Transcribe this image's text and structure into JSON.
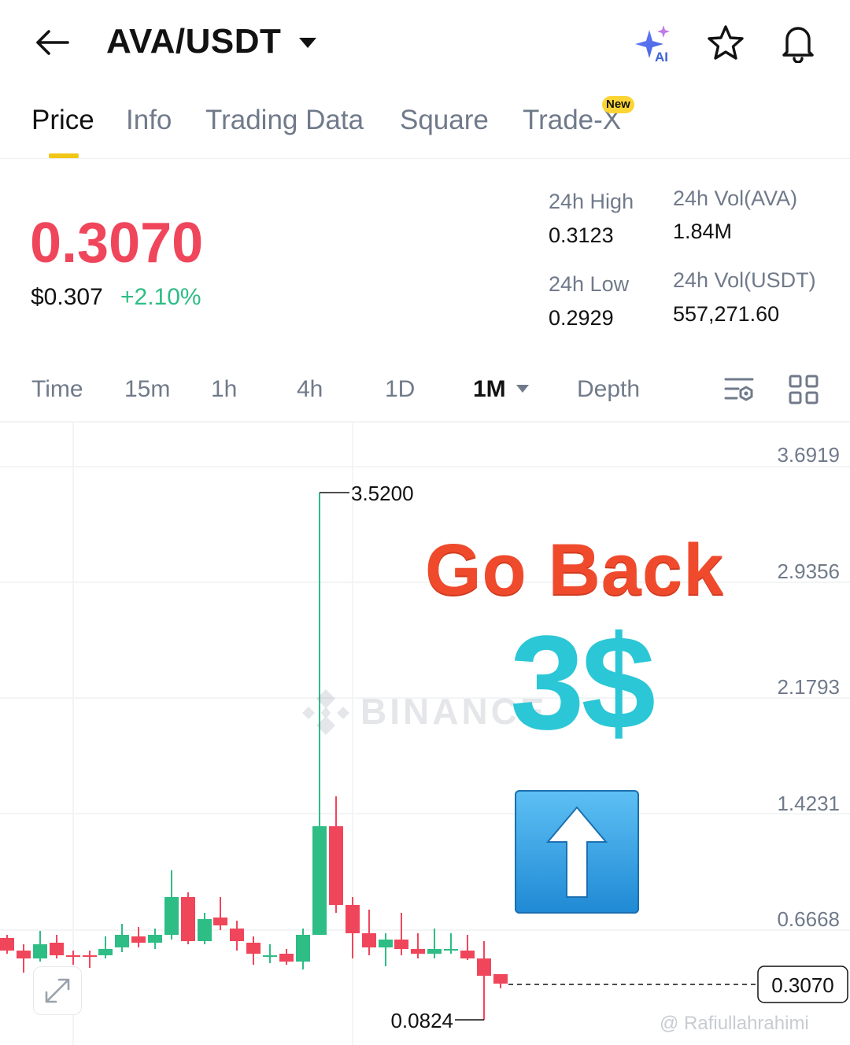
{
  "header": {
    "pair": "AVA/USDT",
    "ai_label": "AI"
  },
  "tabs": [
    {
      "label": "Price",
      "active": true
    },
    {
      "label": "Info"
    },
    {
      "label": "Trading Data"
    },
    {
      "label": "Square"
    },
    {
      "label": "Trade-X",
      "badge": "New"
    }
  ],
  "price": {
    "last": "0.3070",
    "usd": "$0.307",
    "change": "+2.10%",
    "high_label": "24h High",
    "high": "0.3123",
    "low_label": "24h Low",
    "low": "0.2929",
    "vol_base_label": "24h Vol(AVA)",
    "vol_base": "1.84M",
    "vol_quote_label": "24h Vol(USDT)",
    "vol_quote": "557,271.60"
  },
  "intervals": [
    "Time",
    "15m",
    "1h",
    "4h",
    "1D",
    "1M",
    "Depth"
  ],
  "active_interval": "1M",
  "chart": {
    "y_ticks": [
      "3.6919",
      "2.9356",
      "2.1793",
      "1.4231",
      "0.6668"
    ],
    "high_marker": "3.5200",
    "low_marker": "0.0824",
    "current_price_tag": "0.3070",
    "watermark": "BINANCE"
  },
  "overlay": {
    "line1": "Go Back",
    "line2": "3$"
  },
  "credit": "@ Rafiullahrahimi",
  "colors": {
    "up": "#2ebd85",
    "down": "#f0465b",
    "accent": "#fcd535"
  }
}
